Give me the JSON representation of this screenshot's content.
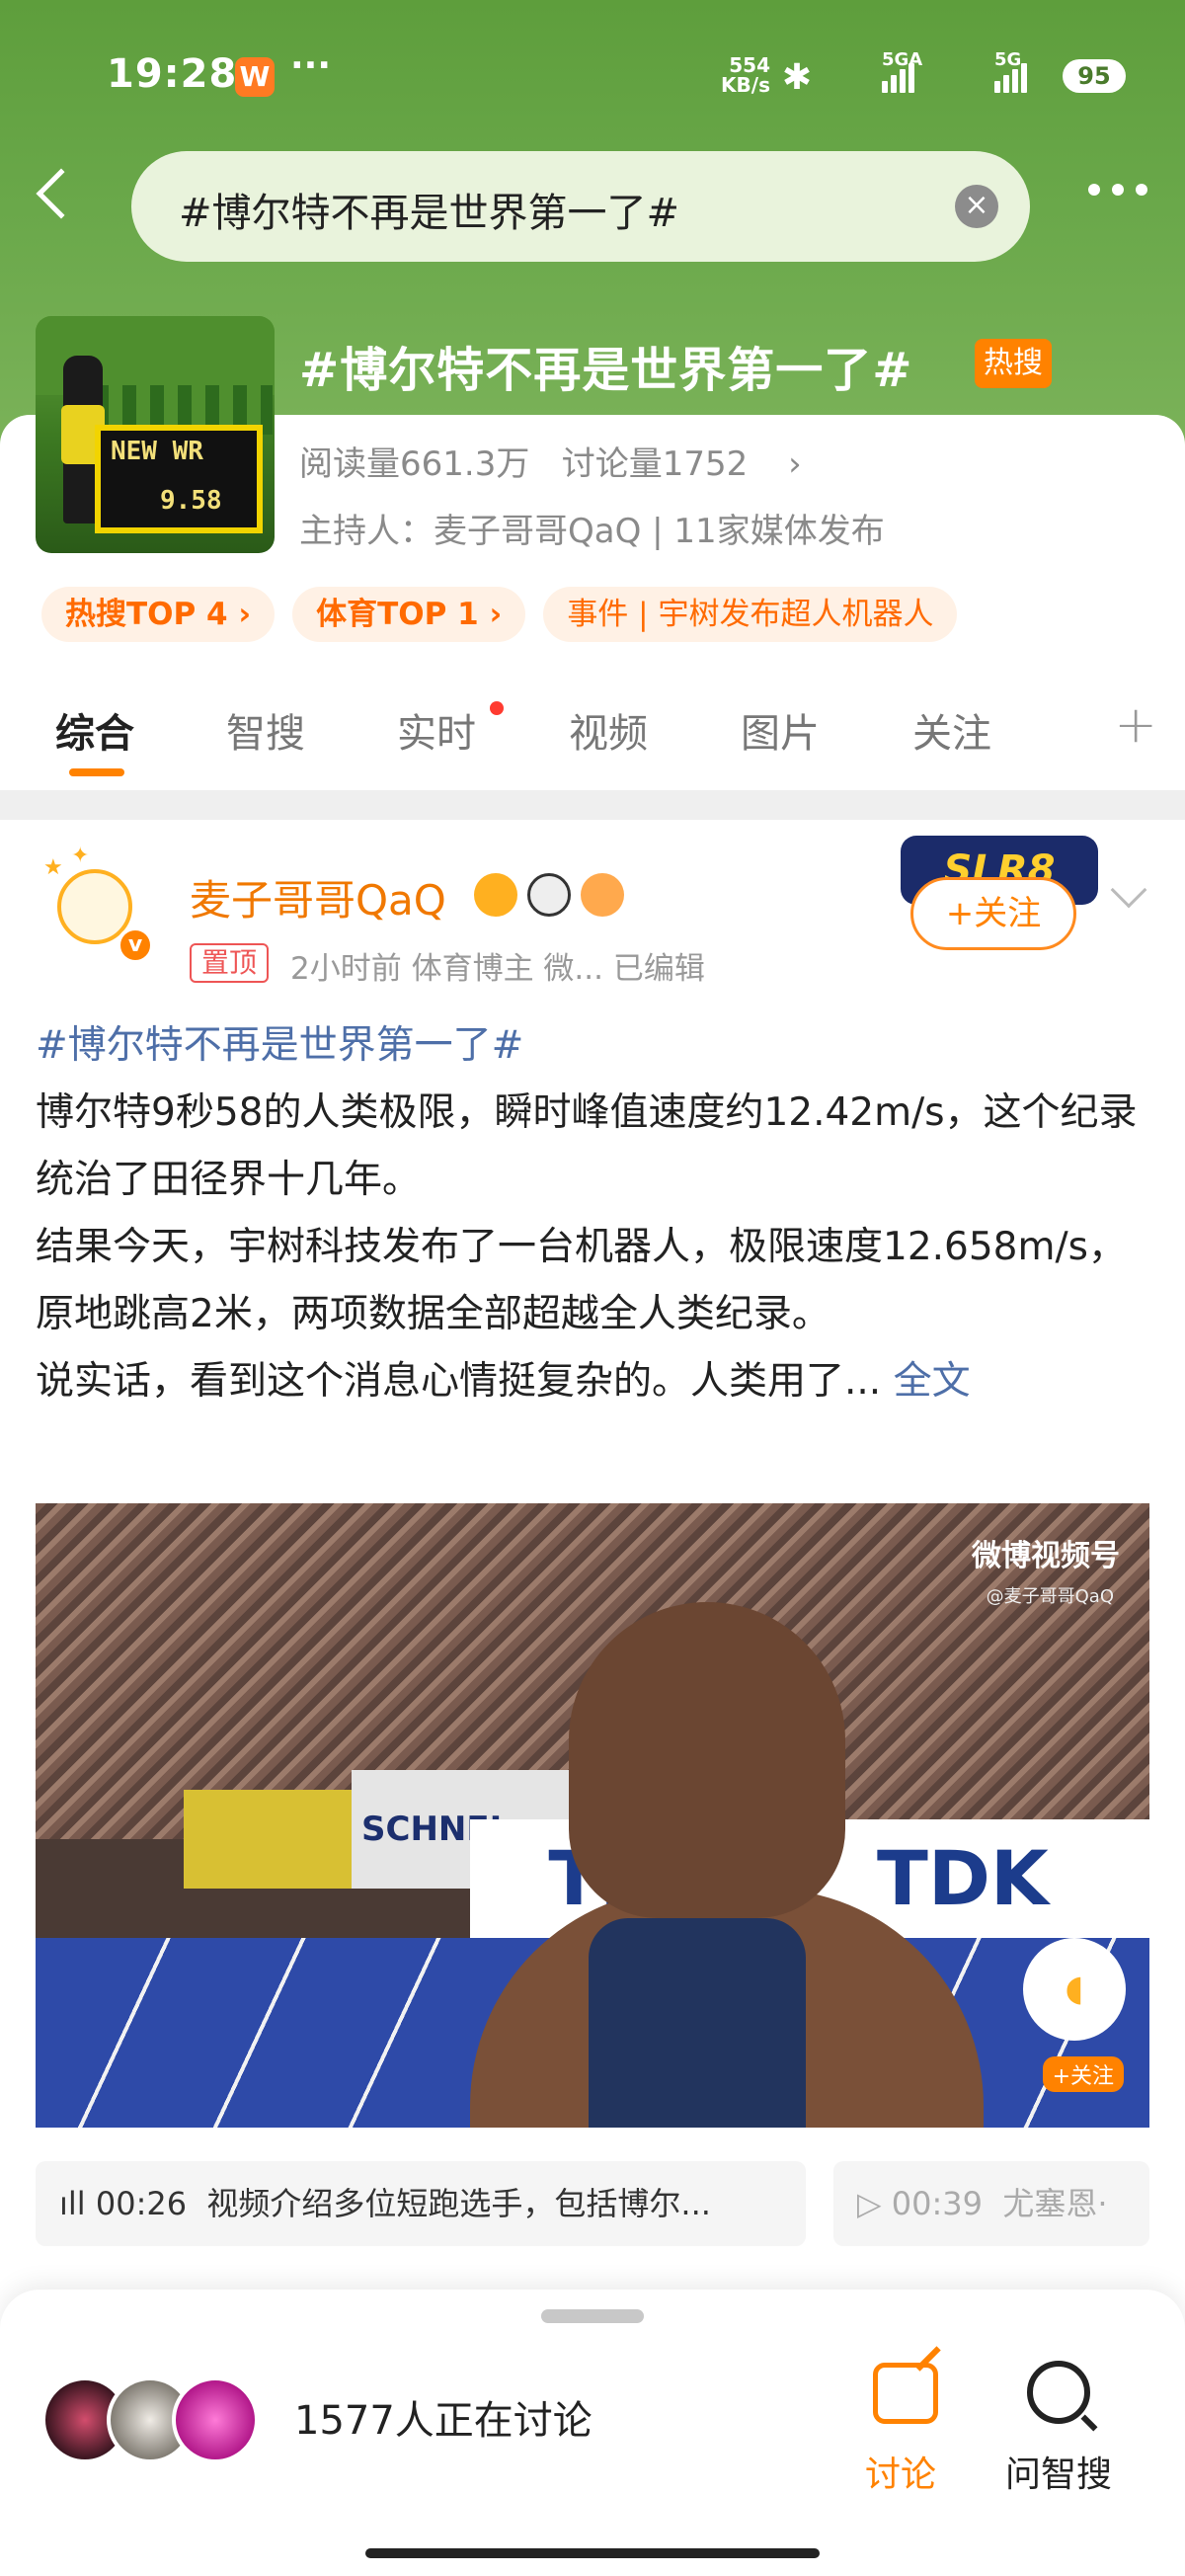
{
  "status_bar": {
    "time": "19:28",
    "app_badge": "W",
    "more": "···",
    "net_speed": "554",
    "net_unit": "KB/s",
    "sim1": "5GA",
    "sim2": "5G",
    "battery": "95"
  },
  "search": {
    "query": "#博尔特不再是世界第一了#"
  },
  "topic": {
    "title": "#博尔特不再是世界第一了#",
    "hot_badge": "热搜",
    "read_label": "阅读量661.3万",
    "discuss_label": "讨论量1752",
    "host": "主持人：麦子哥哥QaQ | 11家媒体发布",
    "thumb_text_wr": "NEW WR",
    "thumb_text_time": "9.58",
    "pills": [
      "热搜TOP 4 ›",
      "体育TOP 1 ›",
      "事件 | 宇树发布超人机器人"
    ]
  },
  "tabs": [
    "综合",
    "智搜",
    "实时",
    "视频",
    "图片",
    "关注"
  ],
  "post": {
    "author": "麦子哥哥QaQ",
    "pinned": "置顶",
    "meta": "2小时前   体育博主 微...    已编辑",
    "follow": "+关注",
    "follow_deco": "SLR8",
    "hashtag": "#博尔特不再是世界第一了#",
    "line1": "博尔特9秒58的人类极限，瞬时峰值速度约12.42m/s，这个纪录统治了田径界十几年。",
    "line2": "结果今天，宇树科技发布了一台机器人，极限速度12.658m/s，原地跳高2米，两项数据全部超越全人类纪录。",
    "line3": "说实话，看到这个消息心情挺复杂的。人类用了...",
    "full_text": "全文"
  },
  "video": {
    "watermark": "微博视频号",
    "watermark_sub": "@麦子哥哥QaQ",
    "banner_text": "SCHNEI",
    "sponsor": "TDK",
    "float_follow": "+关注"
  },
  "chapters": [
    {
      "time": "00:26",
      "text": "视频介绍多位短跑选手，包括博尔..."
    },
    {
      "time": "00:39",
      "text": "尤塞恩·"
    }
  ],
  "bottom": {
    "discussing": "1577人正在讨论",
    "discuss_btn": "讨论",
    "ask_btn": "问智搜"
  }
}
